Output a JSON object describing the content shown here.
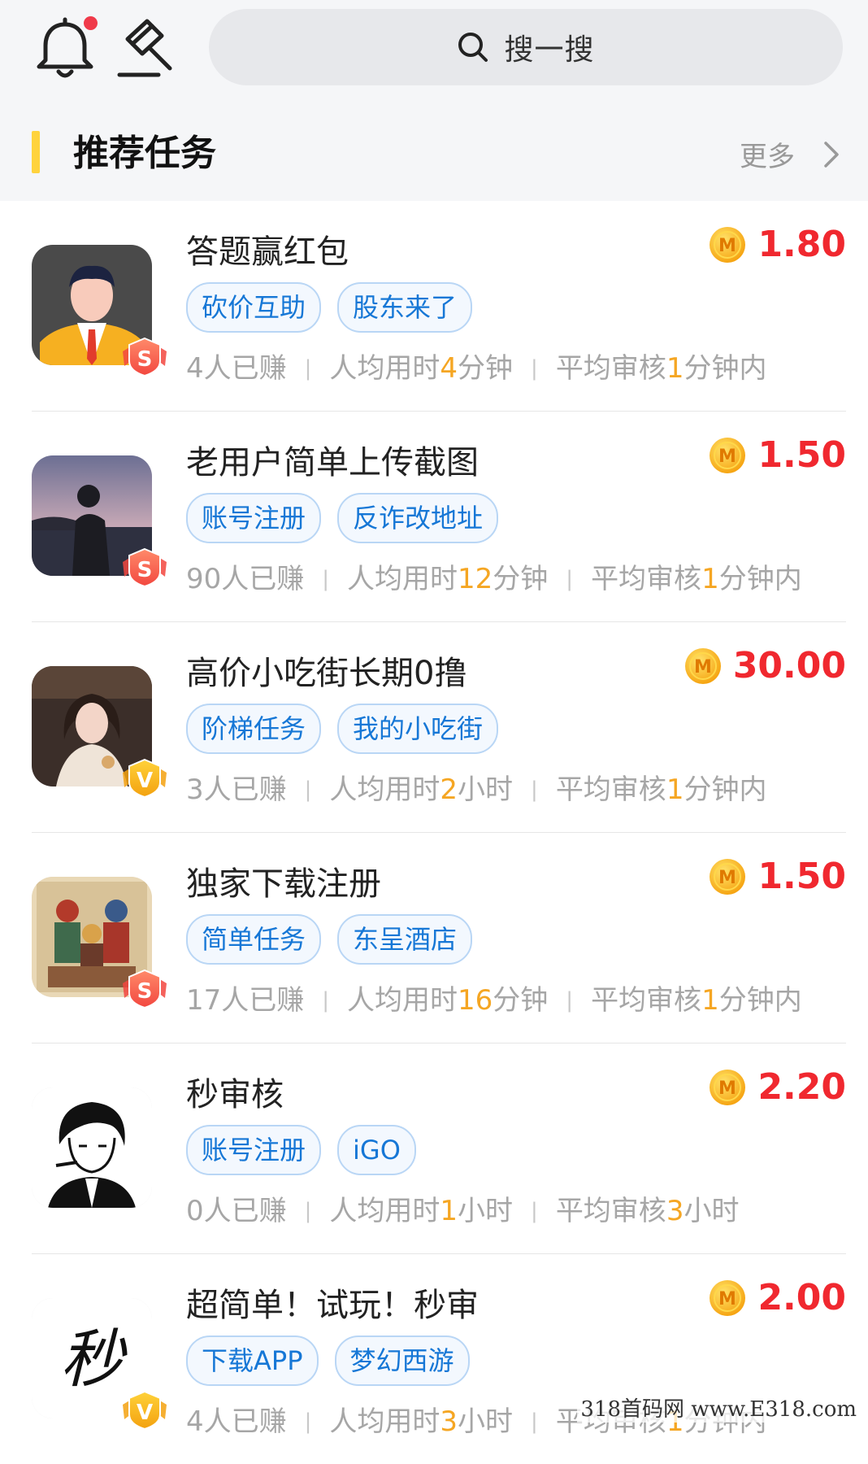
{
  "header": {
    "search_placeholder": "搜一搜",
    "section_title": "推荐任务",
    "more_label": "更多"
  },
  "colors": {
    "price": "#f0282f",
    "accent": "#ffd33d",
    "tag_text": "#1677d6",
    "highlight": "#f5a623"
  },
  "tasks": [
    {
      "title": "答题赢红包",
      "price": "1.80",
      "badge": "S",
      "tags": [
        "砍价互助",
        "股东来了"
      ],
      "earned_pre": "4",
      "earned_post": "人已赚",
      "time_pre": "人均用时",
      "time_num": "4",
      "time_unit": "分钟",
      "review_pre": "平均审核",
      "review_num": "1",
      "review_unit": "分钟内"
    },
    {
      "title": "老用户简单上传截图",
      "price": "1.50",
      "badge": "S",
      "tags": [
        "账号注册",
        "反诈改地址"
      ],
      "earned_pre": "90",
      "earned_post": "人已赚",
      "time_pre": "人均用时",
      "time_num": "12",
      "time_unit": "分钟",
      "review_pre": "平均审核",
      "review_num": "1",
      "review_unit": "分钟内"
    },
    {
      "title": "高价小吃街长期0撸",
      "price": "30.00",
      "badge": "V",
      "tags": [
        "阶梯任务",
        "我的小吃街"
      ],
      "earned_pre": "3",
      "earned_post": "人已赚",
      "time_pre": "人均用时",
      "time_num": "2",
      "time_unit": "小时",
      "review_pre": "平均审核",
      "review_num": "1",
      "review_unit": "分钟内"
    },
    {
      "title": "独家下载注册",
      "price": "1.50",
      "badge": "S",
      "tags": [
        "简单任务",
        "东呈酒店"
      ],
      "earned_pre": "17",
      "earned_post": "人已赚",
      "time_pre": "人均用时",
      "time_num": "16",
      "time_unit": "分钟",
      "review_pre": "平均审核",
      "review_num": "1",
      "review_unit": "分钟内"
    },
    {
      "title": "秒审核",
      "price": "2.20",
      "badge": "",
      "tags": [
        "账号注册",
        "iGO"
      ],
      "earned_pre": "0",
      "earned_post": "人已赚",
      "time_pre": "人均用时",
      "time_num": "1",
      "time_unit": "小时",
      "review_pre": "平均审核",
      "review_num": "3",
      "review_unit": "小时"
    },
    {
      "title": "超简单！试玩！秒审",
      "price": "2.00",
      "badge": "V",
      "tags": [
        "下载APP",
        "梦幻西游"
      ],
      "earned_pre": "4",
      "earned_post": "人已赚",
      "time_pre": "人均用时",
      "time_num": "3",
      "time_unit": "小时",
      "review_pre": "平均审核",
      "review_num": "1",
      "review_unit": "分钟内"
    }
  ],
  "avatar_icons": [
    "businessman-avatar",
    "lakeside-person-avatar",
    "woman-portrait-avatar",
    "door-gods-painting-avatar",
    "sketch-man-avatar",
    "calligraphy-miao-avatar"
  ],
  "avatar_text": {
    "miao": "秒"
  },
  "coin_letter": "M",
  "watermark": "318首码网 www.E318.com"
}
